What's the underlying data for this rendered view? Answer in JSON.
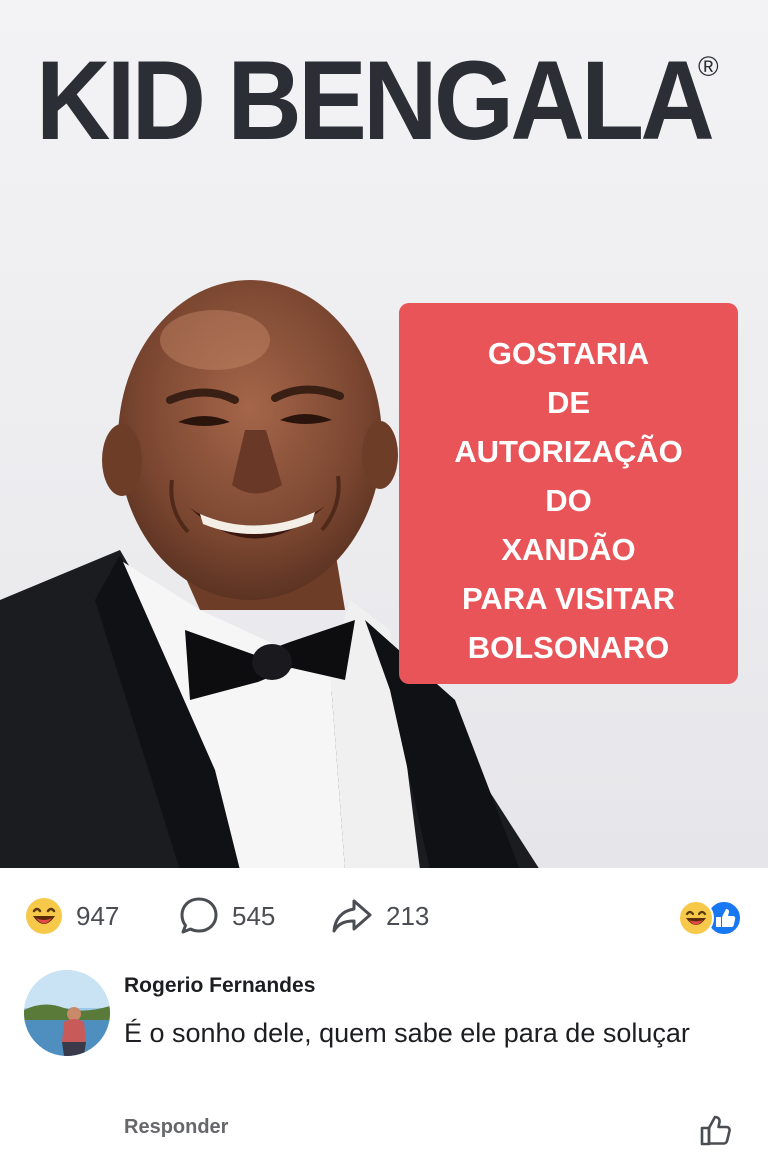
{
  "post": {
    "image": {
      "brand_title": "KID BENGALA",
      "registered_mark": "®",
      "message_lines": [
        "GOSTARIA",
        "DE",
        "AUTORIZAÇÃO",
        "DO",
        "XANDÃO",
        "PARA VISITAR",
        "BOLSONARO"
      ],
      "colors": {
        "brand_text": "#2c2e35",
        "message_box": "#e85458",
        "message_text": "#ffffff"
      }
    },
    "stats": {
      "reactions_count": "947",
      "comments_count": "545",
      "shares_count": "213",
      "reaction_types": [
        "haha",
        "like"
      ]
    }
  },
  "comment": {
    "author": "Rogerio Fernandes",
    "text": "É o sonho dele, quem sabe ele para de soluçar",
    "reply_label": "Responder"
  },
  "colors": {
    "accent_blue": "#1877f2",
    "haha_yellow": "#f7c94b",
    "muted_text": "#65676b"
  }
}
